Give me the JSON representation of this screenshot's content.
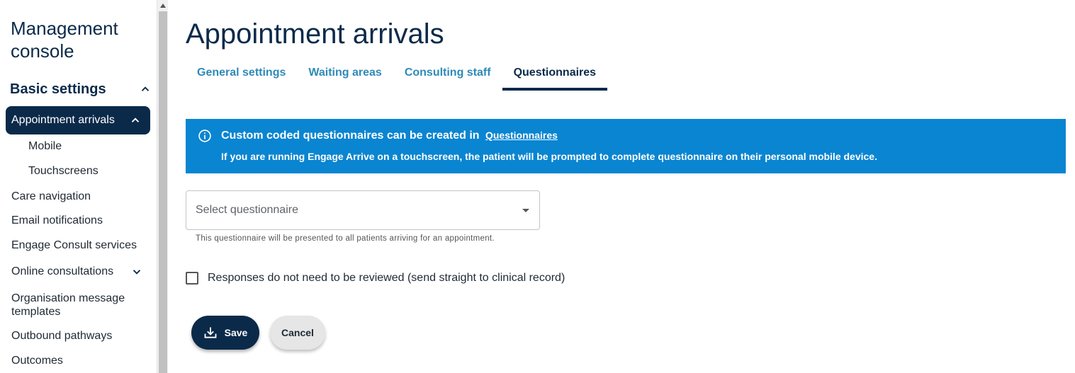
{
  "sidebar": {
    "title": "Management console",
    "section": {
      "label": "Basic settings",
      "expanded": true
    },
    "active_item": {
      "label": "Appointment arrivals",
      "expanded": true,
      "children": [
        "Mobile",
        "Touchscreens"
      ]
    },
    "items": [
      "Care navigation",
      "Email notifications",
      "Engage Consult services",
      "Online consultations",
      "Organisation message templates",
      "Outbound pathways",
      "Outcomes"
    ],
    "icons": {
      "section_toggle": "chevron-up-icon",
      "active_toggle": "chevron-up-icon",
      "online_consultations_toggle": "chevron-down-icon"
    }
  },
  "main": {
    "title": "Appointment arrivals",
    "tabs": [
      {
        "label": "General settings",
        "active": false
      },
      {
        "label": "Waiting areas",
        "active": false
      },
      {
        "label": "Consulting staff",
        "active": false
      },
      {
        "label": "Questionnaires",
        "active": true
      }
    ],
    "banner": {
      "icon": "info-icon",
      "line1": "Custom coded questionnaires can be created in",
      "link": "Questionnaires",
      "line2": "If you are running Engage Arrive on a touchscreen, the patient will be prompted to complete questionnaire on their personal mobile device."
    },
    "select": {
      "placeholder": "Select questionnaire",
      "helper": "This questionnaire will be presented to all patients arriving for an appointment."
    },
    "checkbox": {
      "label": "Responses do not need to be reviewed (send straight to clinical record)",
      "checked": false
    },
    "buttons": {
      "save": "Save",
      "cancel": "Cancel"
    }
  },
  "colors": {
    "primary": "#0b2a4a",
    "tab_link": "#2f8ab8",
    "banner": "#0a85d1"
  }
}
